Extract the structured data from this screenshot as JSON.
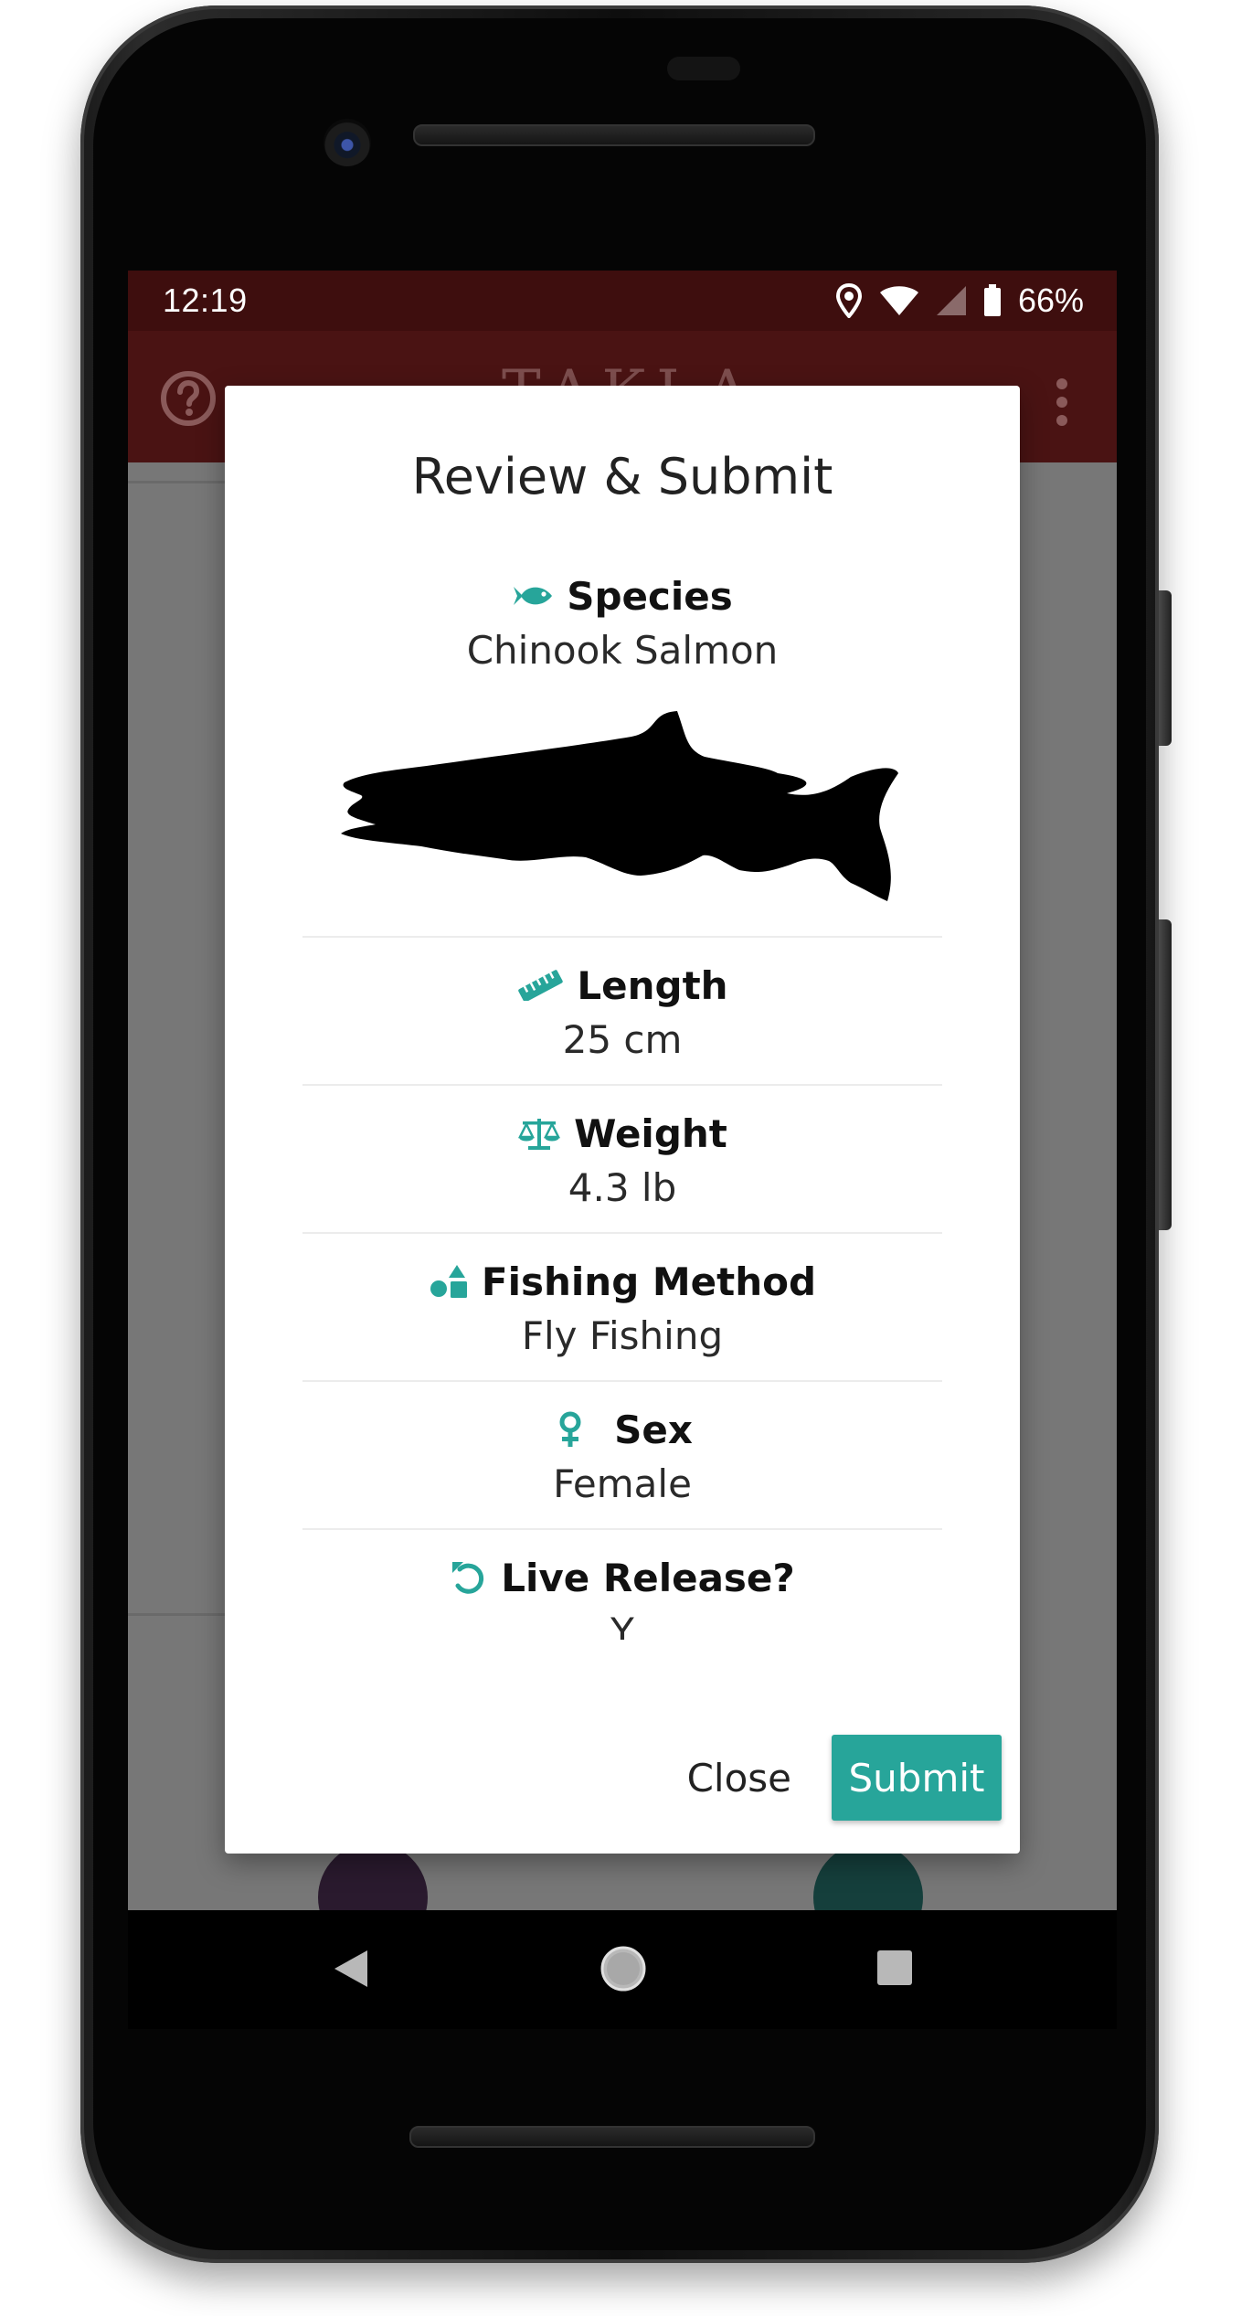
{
  "status_bar": {
    "time": "12:19",
    "battery_percent": "66%",
    "icons": [
      "location-icon",
      "wifi-icon",
      "cell-signal-icon",
      "battery-icon"
    ]
  },
  "app_bar": {
    "title": "TAKLA NATION",
    "help_icon": "help-circle-icon",
    "menu_icon": "overflow-menu-icon"
  },
  "dialog": {
    "title": "Review & Submit",
    "species": {
      "label": "Species",
      "value": "Chinook Salmon",
      "icon": "fish-icon"
    },
    "length": {
      "label": "Length",
      "value": "25 cm",
      "icon": "ruler-icon"
    },
    "weight": {
      "label": "Weight",
      "value": "4.3 lb",
      "icon": "balance-scale-icon"
    },
    "fishing_method": {
      "label": "Fishing Method",
      "value": "Fly Fishing",
      "icon": "shapes-icon"
    },
    "sex": {
      "label": "Sex",
      "value": "Female",
      "icon": "female-icon"
    },
    "live_release": {
      "label": "Live Release?",
      "value": "Y",
      "icon": "undo-icon"
    },
    "actions": {
      "close_label": "Close",
      "submit_label": "Submit"
    }
  },
  "colors": {
    "accent": "#27a59a",
    "status_bar": "#3e0e0e",
    "app_bar": "#4a1313",
    "scrim": "#777777"
  }
}
